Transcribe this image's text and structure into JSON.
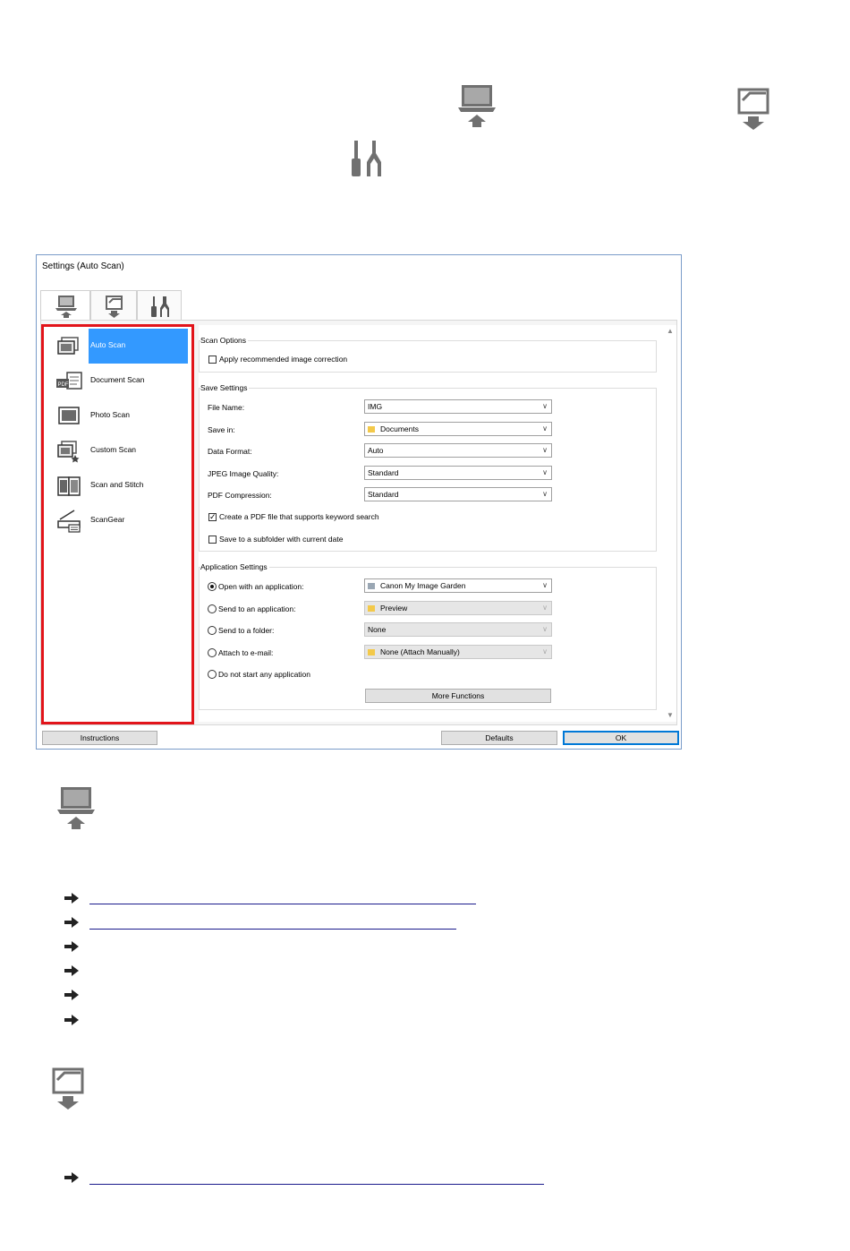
{
  "dialog": {
    "title": "Settings (Auto Scan)",
    "tabs": [
      "scan-from-computer-tab",
      "scan-from-operation-panel-tab",
      "general-settings-tab"
    ],
    "nav_items": [
      {
        "label": "Auto Scan",
        "icon": "auto-scan-icon",
        "selected": true
      },
      {
        "label": "Document Scan",
        "icon": "document-scan-icon",
        "selected": false
      },
      {
        "label": "Photo Scan",
        "icon": "photo-scan-icon",
        "selected": false
      },
      {
        "label": "Custom Scan",
        "icon": "custom-scan-icon",
        "selected": false
      },
      {
        "label": "Scan and Stitch",
        "icon": "scan-and-stitch-icon",
        "selected": false
      },
      {
        "label": "ScanGear",
        "icon": "scangear-icon",
        "selected": false
      }
    ],
    "scan_options": {
      "group_label": "Scan Options",
      "apply_correction": "Apply recommended image correction"
    },
    "save_settings": {
      "group_label": "Save Settings",
      "file_name_label": "File Name:",
      "file_name_value": "IMG",
      "save_in_label": "Save in:",
      "save_in_value": "Documents",
      "data_format_label": "Data Format:",
      "data_format_value": "Auto",
      "jpeg_quality_label": "JPEG Image Quality:",
      "jpeg_quality_value": "Standard",
      "pdf_compression_label": "PDF Compression:",
      "pdf_compression_value": "Standard",
      "keyword_pdf": "Create a PDF file that supports keyword search",
      "subfolder": "Save to a subfolder with current date"
    },
    "application_settings": {
      "group_label": "Application Settings",
      "open_with_app": "Open with an application:",
      "open_with_app_value": "Canon My Image Garden",
      "send_to_app": "Send to an application:",
      "send_to_app_value": "Preview",
      "send_to_folder": "Send to a folder:",
      "send_to_folder_value": "None",
      "attach_email": "Attach to e-mail:",
      "attach_email_value": "None (Attach Manually)",
      "no_app": "Do not start any application",
      "more_functions": "More Functions"
    },
    "buttons": {
      "instructions": "Instructions",
      "defaults": "Defaults",
      "ok": "OK"
    }
  },
  "colors": {
    "highlight_border": "#e2141a",
    "selection": "#3399ff",
    "link": "#1a1a8c"
  }
}
